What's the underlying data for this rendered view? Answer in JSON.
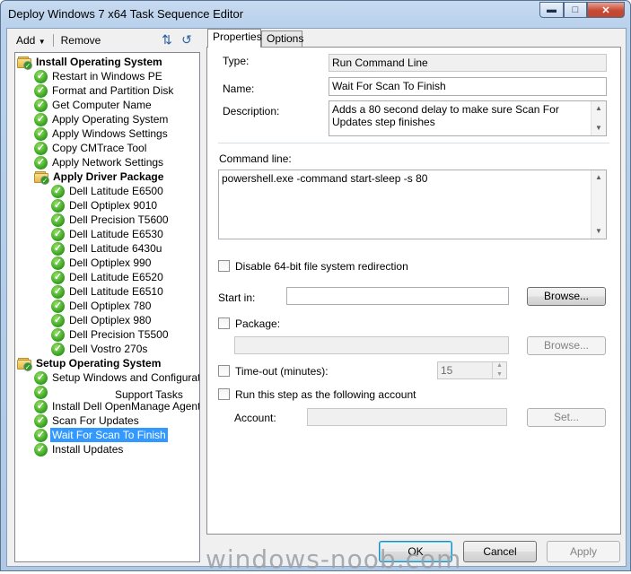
{
  "window": {
    "title": "Deploy Windows 7 x64 Task Sequence Editor"
  },
  "toolbar": {
    "add_label": "Add",
    "remove_label": "Remove"
  },
  "tree": {
    "items": [
      {
        "label": "Install Operating System",
        "kind": "group",
        "level": 0
      },
      {
        "label": "Restart in Windows PE",
        "kind": "step",
        "level": 1
      },
      {
        "label": "Format and Partition Disk",
        "kind": "step",
        "level": 1
      },
      {
        "label": "Get Computer Name",
        "kind": "step",
        "level": 1
      },
      {
        "label": "Apply Operating System",
        "kind": "step",
        "level": 1
      },
      {
        "label": "Apply Windows Settings",
        "kind": "step",
        "level": 1
      },
      {
        "label": "Copy CMTrace Tool",
        "kind": "step",
        "level": 1
      },
      {
        "label": "Apply Network Settings",
        "kind": "step",
        "level": 1
      },
      {
        "label": "Apply Driver Package",
        "kind": "group",
        "level": 1
      },
      {
        "label": "Dell Latitude E6500",
        "kind": "step",
        "level": 2
      },
      {
        "label": "Dell Optiplex 9010",
        "kind": "step",
        "level": 2
      },
      {
        "label": "Dell Precision T5600",
        "kind": "step",
        "level": 2
      },
      {
        "label": "Dell Latitude E6530",
        "kind": "step",
        "level": 2
      },
      {
        "label": "Dell Latitude 6430u",
        "kind": "step",
        "level": 2
      },
      {
        "label": "Dell Optiplex 990",
        "kind": "step",
        "level": 2
      },
      {
        "label": "Dell Latitude E6520",
        "kind": "step",
        "level": 2
      },
      {
        "label": "Dell Latitude E6510",
        "kind": "step",
        "level": 2
      },
      {
        "label": "Dell Optiplex 780",
        "kind": "step",
        "level": 2
      },
      {
        "label": "Dell Optiplex 980",
        "kind": "step",
        "level": 2
      },
      {
        "label": "Dell Precision T5500",
        "kind": "step",
        "level": 2
      },
      {
        "label": "Dell Vostro 270s",
        "kind": "step",
        "level": 2
      },
      {
        "label": "Setup Operating System",
        "kind": "group",
        "level": 0
      },
      {
        "label": "Setup Windows and Configuration",
        "kind": "step",
        "level": 1
      },
      {
        "label": "",
        "kind": "step",
        "level": 1
      },
      {
        "label": "Install Dell OpenManage Agent",
        "kind": "step",
        "level": 1
      },
      {
        "label": "Scan For Updates",
        "kind": "step",
        "level": 1
      },
      {
        "label": "Wait For Scan To Finish",
        "kind": "step",
        "level": 1,
        "selected": true
      },
      {
        "label": "Install Updates",
        "kind": "step",
        "level": 1
      }
    ],
    "ghost_text": "Support Tasks"
  },
  "tabs": {
    "properties": "Properties",
    "options": "Options"
  },
  "properties": {
    "type_label": "Type:",
    "type_value": "Run Command Line",
    "name_label": "Name:",
    "name_value": "Wait For Scan To Finish",
    "description_label": "Description:",
    "description_value": "Adds a 80 second delay to make sure Scan For Updates step finishes",
    "command_line_label": "Command line:",
    "command_line_value": "powershell.exe -command start-sleep -s 80",
    "disable_redirection_label": "Disable 64-bit file system redirection",
    "start_in_label": "Start in:",
    "start_in_value": "",
    "browse_label": "Browse...",
    "package_label": "Package:",
    "package_value": "",
    "package_browse_label": "Browse...",
    "timeout_label": "Time-out (minutes):",
    "timeout_value": "15",
    "run_as_label": "Run this step as the following account",
    "account_label": "Account:",
    "account_value": "",
    "set_label": "Set..."
  },
  "buttons": {
    "ok": "OK",
    "cancel": "Cancel",
    "apply": "Apply"
  },
  "watermark": "windows-noob.com"
}
